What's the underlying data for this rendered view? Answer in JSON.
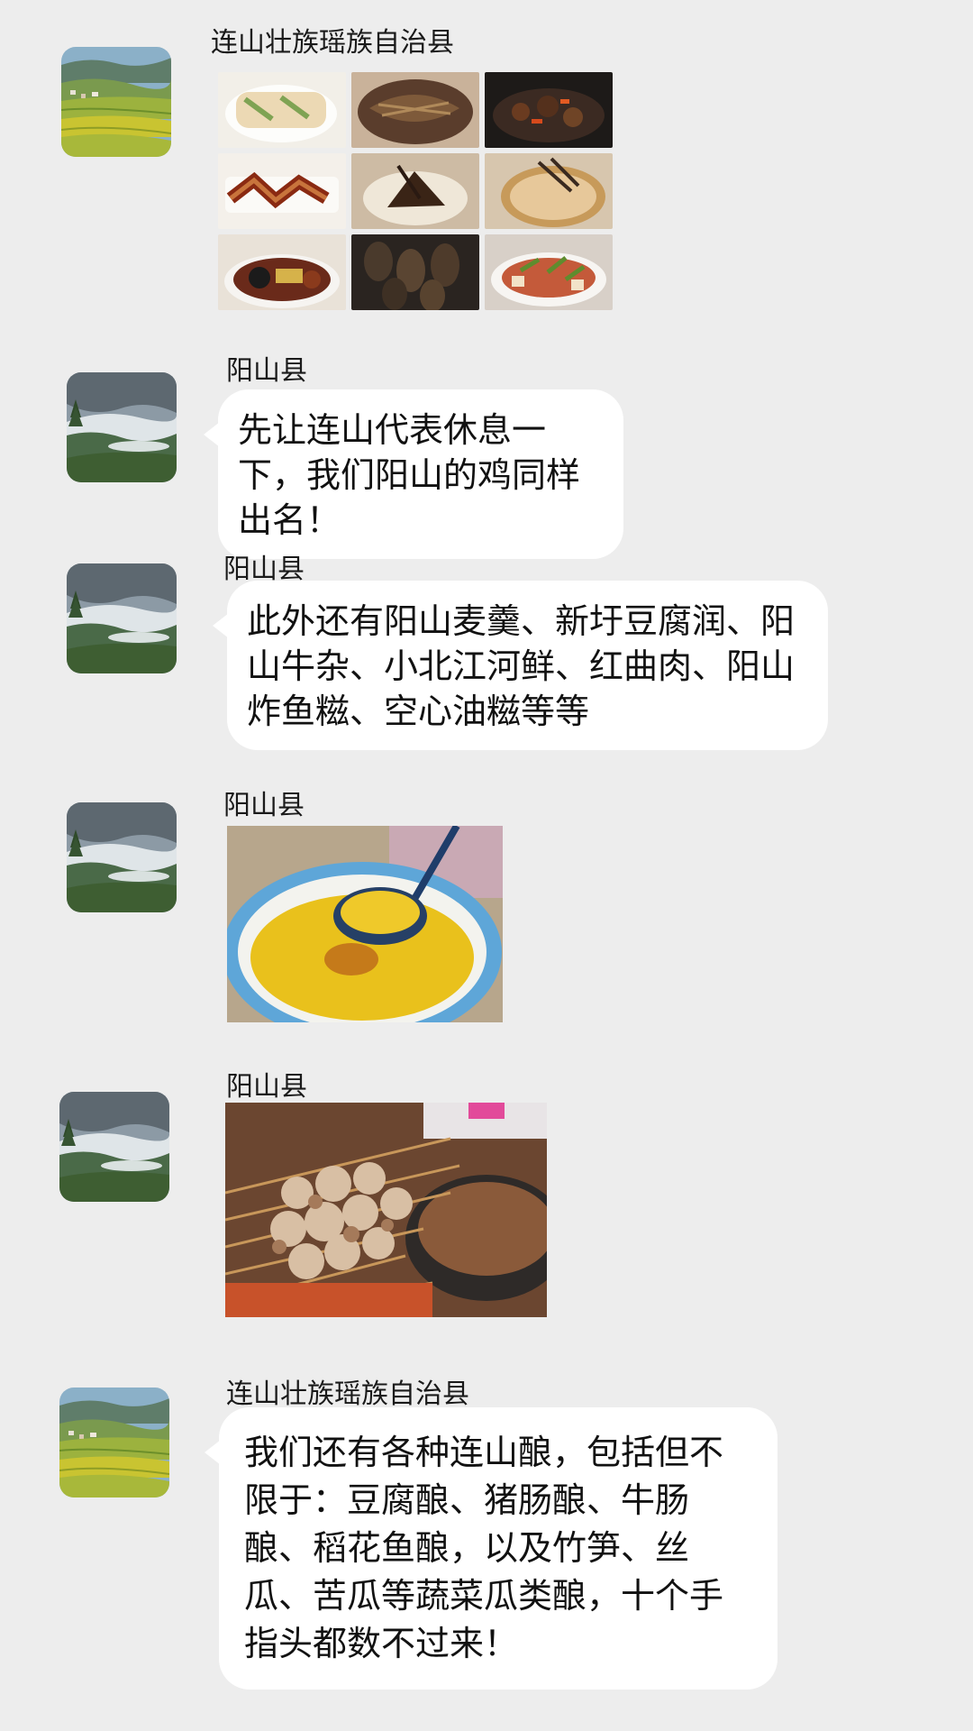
{
  "messages": [
    {
      "sender": "连山壮族瑶族自治县",
      "avatar_icon": "terraced-fields-avatar",
      "type": "image-grid",
      "image_description": "food-collage-9"
    },
    {
      "sender": "阳山县",
      "avatar_icon": "misty-mountain-avatar",
      "type": "text",
      "text": "先让连山代表休息一下，我们阳山的鸡同样出名！"
    },
    {
      "sender": "阳山县",
      "avatar_icon": "misty-mountain-avatar",
      "type": "text",
      "text": "此外还有阳山麦羹、新圩豆腐润、阳山牛杂、小北江河鲜、红曲肉、阳山炸鱼糍、空心油糍等等"
    },
    {
      "sender": "阳山县",
      "avatar_icon": "misty-mountain-avatar",
      "type": "image",
      "image_description": "yellow-soup-bowl"
    },
    {
      "sender": "阳山县",
      "avatar_icon": "misty-mountain-avatar",
      "type": "image",
      "image_description": "beef-offal-skewers"
    },
    {
      "sender": "连山壮族瑶族自治县",
      "avatar_icon": "terraced-fields-avatar",
      "type": "text",
      "text": "我们还有各种连山酿，包括但不限于：豆腐酿、猪肠酿、牛肠酿、稻花鱼酿，以及竹笋、丝瓜、苦瓜等蔬菜瓜类酿，十个手指头都数不过来！"
    }
  ],
  "colors": {
    "background": "#ededed",
    "bubble": "#ffffff",
    "text": "#111111"
  }
}
